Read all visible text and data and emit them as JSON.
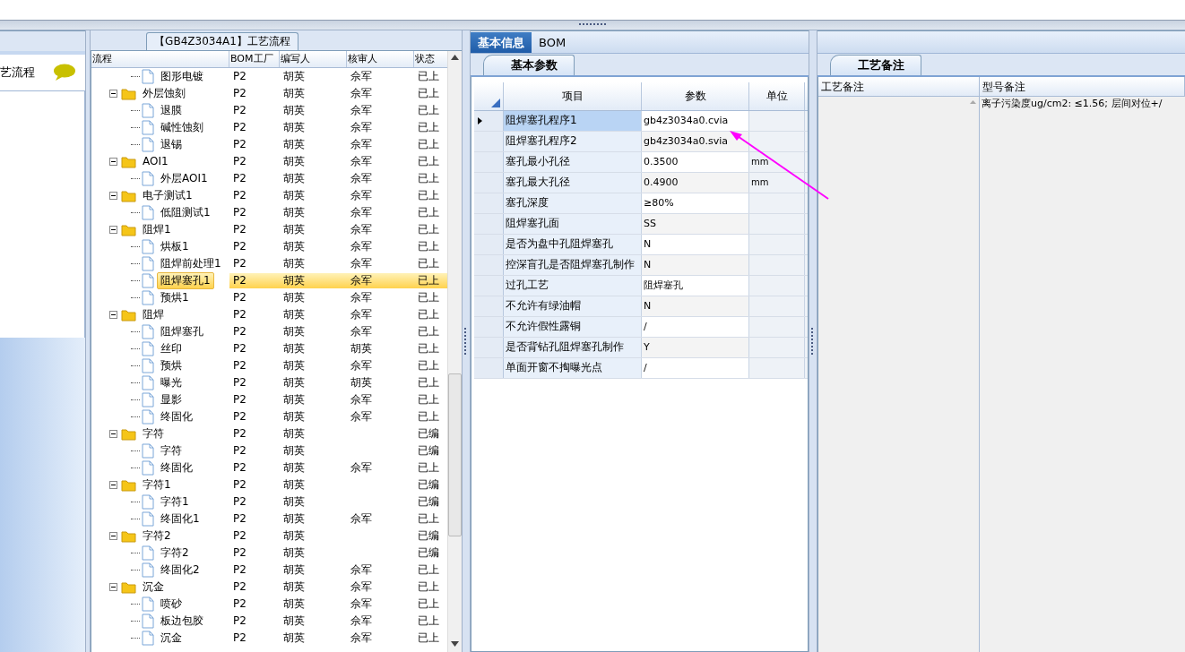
{
  "left_panel": {
    "title": "艺流程"
  },
  "tree": {
    "title": "【GB4Z3034A1】工艺流程",
    "columns": [
      "流程",
      "BOM工厂",
      "编写人",
      "核审人",
      "状态"
    ],
    "nodes": [
      {
        "children": [
          {
            "label": "图形电镀",
            "bom": "P2",
            "author": "胡英",
            "reviewer": "佘军",
            "status": "已上",
            "selected": false
          }
        ]
      },
      {
        "label": "外层蚀刻",
        "bom": "P2",
        "author": "胡英",
        "reviewer": "佘军",
        "status": "已上",
        "selected": false,
        "expanded": true,
        "children": [
          {
            "label": "退膜",
            "bom": "P2",
            "author": "胡英",
            "reviewer": "佘军",
            "status": "已上",
            "selected": false
          },
          {
            "label": "碱性蚀刻",
            "bom": "P2",
            "author": "胡英",
            "reviewer": "佘军",
            "status": "已上",
            "selected": false
          },
          {
            "label": "退锡",
            "bom": "P2",
            "author": "胡英",
            "reviewer": "佘军",
            "status": "已上",
            "selected": false
          }
        ]
      },
      {
        "label": "AOI1",
        "bom": "P2",
        "author": "胡英",
        "reviewer": "佘军",
        "status": "已上",
        "selected": false,
        "expanded": true,
        "children": [
          {
            "label": "外层AOI1",
            "bom": "P2",
            "author": "胡英",
            "reviewer": "佘军",
            "status": "已上",
            "selected": false
          }
        ]
      },
      {
        "label": "电子测试1",
        "bom": "P2",
        "author": "胡英",
        "reviewer": "佘军",
        "status": "已上",
        "selected": false,
        "expanded": true,
        "children": [
          {
            "label": "低阻测试1",
            "bom": "P2",
            "author": "胡英",
            "reviewer": "佘军",
            "status": "已上",
            "selected": false
          }
        ]
      },
      {
        "label": "阻焊1",
        "bom": "P2",
        "author": "胡英",
        "reviewer": "佘军",
        "status": "已上",
        "selected": false,
        "expanded": true,
        "children": [
          {
            "label": "烘板1",
            "bom": "P2",
            "author": "胡英",
            "reviewer": "佘军",
            "status": "已上",
            "selected": false
          },
          {
            "label": "阻焊前处理1",
            "bom": "P2",
            "author": "胡英",
            "reviewer": "佘军",
            "status": "已上",
            "selected": false
          },
          {
            "label": "阻焊塞孔1",
            "bom": "P2",
            "author": "胡英",
            "reviewer": "佘军",
            "status": "已上",
            "selected": true
          },
          {
            "label": "预烘1",
            "bom": "P2",
            "author": "胡英",
            "reviewer": "佘军",
            "status": "已上",
            "selected": false
          }
        ]
      },
      {
        "label": "阻焊",
        "bom": "P2",
        "author": "胡英",
        "reviewer": "佘军",
        "status": "已上",
        "selected": false,
        "expanded": true,
        "children": [
          {
            "label": "阻焊塞孔",
            "bom": "P2",
            "author": "胡英",
            "reviewer": "佘军",
            "status": "已上",
            "selected": false
          },
          {
            "label": "丝印",
            "bom": "P2",
            "author": "胡英",
            "reviewer": "胡英",
            "status": "已上",
            "selected": false
          },
          {
            "label": "预烘",
            "bom": "P2",
            "author": "胡英",
            "reviewer": "佘军",
            "status": "已上",
            "selected": false
          },
          {
            "label": "曝光",
            "bom": "P2",
            "author": "胡英",
            "reviewer": "胡英",
            "status": "已上",
            "selected": false
          },
          {
            "label": "显影",
            "bom": "P2",
            "author": "胡英",
            "reviewer": "佘军",
            "status": "已上",
            "selected": false
          },
          {
            "label": "终固化",
            "bom": "P2",
            "author": "胡英",
            "reviewer": "佘军",
            "status": "已上",
            "selected": false
          }
        ]
      },
      {
        "label": "字符",
        "bom": "P2",
        "author": "胡英",
        "status": "已编",
        "selected": false,
        "expanded": true,
        "children": [
          {
            "label": "字符",
            "bom": "P2",
            "author": "胡英",
            "status": "已编",
            "selected": false
          },
          {
            "label": "终固化",
            "bom": "P2",
            "author": "胡英",
            "reviewer": "佘军",
            "status": "已上",
            "selected": false
          }
        ]
      },
      {
        "label": "字符1",
        "bom": "P2",
        "author": "胡英",
        "status": "已编",
        "selected": false,
        "expanded": true,
        "children": [
          {
            "label": "字符1",
            "bom": "P2",
            "author": "胡英",
            "status": "已编",
            "selected": false
          },
          {
            "label": "终固化1",
            "bom": "P2",
            "author": "胡英",
            "reviewer": "佘军",
            "status": "已上",
            "selected": false
          }
        ]
      },
      {
        "label": "字符2",
        "bom": "P2",
        "author": "胡英",
        "status": "已编",
        "selected": false,
        "expanded": true,
        "children": [
          {
            "label": "字符2",
            "bom": "P2",
            "author": "胡英",
            "status": "已编",
            "selected": false
          },
          {
            "label": "终固化2",
            "bom": "P2",
            "author": "胡英",
            "reviewer": "佘军",
            "status": "已上",
            "selected": false
          }
        ]
      },
      {
        "label": "沉金",
        "bom": "P2",
        "author": "胡英",
        "reviewer": "佘军",
        "status": "已上",
        "selected": false,
        "expanded": true,
        "children": [
          {
            "label": "喷砂",
            "bom": "P2",
            "author": "胡英",
            "reviewer": "佘军",
            "status": "已上",
            "selected": false
          },
          {
            "label": "板边包胶",
            "bom": "P2",
            "author": "胡英",
            "reviewer": "佘军",
            "status": "已上",
            "selected": false
          },
          {
            "label": "沉金",
            "bom": "P2",
            "author": "胡英",
            "reviewer": "佘军",
            "status": "已上",
            "selected": false
          }
        ]
      }
    ]
  },
  "params": {
    "tabs": [
      {
        "label": "基本信息",
        "selected": true
      },
      {
        "label": "BOM",
        "selected": false
      }
    ],
    "subtab": "基本参数",
    "columns": [
      "项目",
      "参数",
      "单位"
    ],
    "rows": [
      {
        "item": "阻焊塞孔程序1",
        "value": "gb4z3034a0.cvia",
        "selected": true
      },
      {
        "item": "阻焊塞孔程序2",
        "value": "gb4z3034a0.svia",
        "selected": false
      },
      {
        "item": "塞孔最小孔径",
        "value": "0.3500",
        "unit": "mm",
        "selected": false
      },
      {
        "item": "塞孔最大孔径",
        "value": "0.4900",
        "unit": "mm",
        "selected": false
      },
      {
        "item": "塞孔深度",
        "value": "≥80%",
        "selected": false
      },
      {
        "item": "阻焊塞孔面",
        "value": "SS",
        "selected": false
      },
      {
        "item": "是否为盘中孔阻焊塞孔",
        "value": "N",
        "selected": false
      },
      {
        "item": "控深盲孔是否阻焊塞孔制作",
        "value": "N",
        "selected": false
      },
      {
        "item": "过孔工艺",
        "value": "阻焊塞孔",
        "selected": false
      },
      {
        "item": "不允许有绿油帽",
        "value": "N",
        "selected": false
      },
      {
        "item": "不允许假性露铜",
        "value": "/",
        "selected": false
      },
      {
        "item": "是否背钻孔阻焊塞孔制作",
        "value": "Y",
        "selected": false
      },
      {
        "item": "单面开窗不掏曝光点",
        "value": "/",
        "selected": false
      }
    ]
  },
  "notes": {
    "subtab": "工艺备注",
    "columns": [
      "工艺备注",
      "型号备注"
    ],
    "model_note": "离子污染度ug/cm2: ≤1.56; 层间对位+/"
  }
}
